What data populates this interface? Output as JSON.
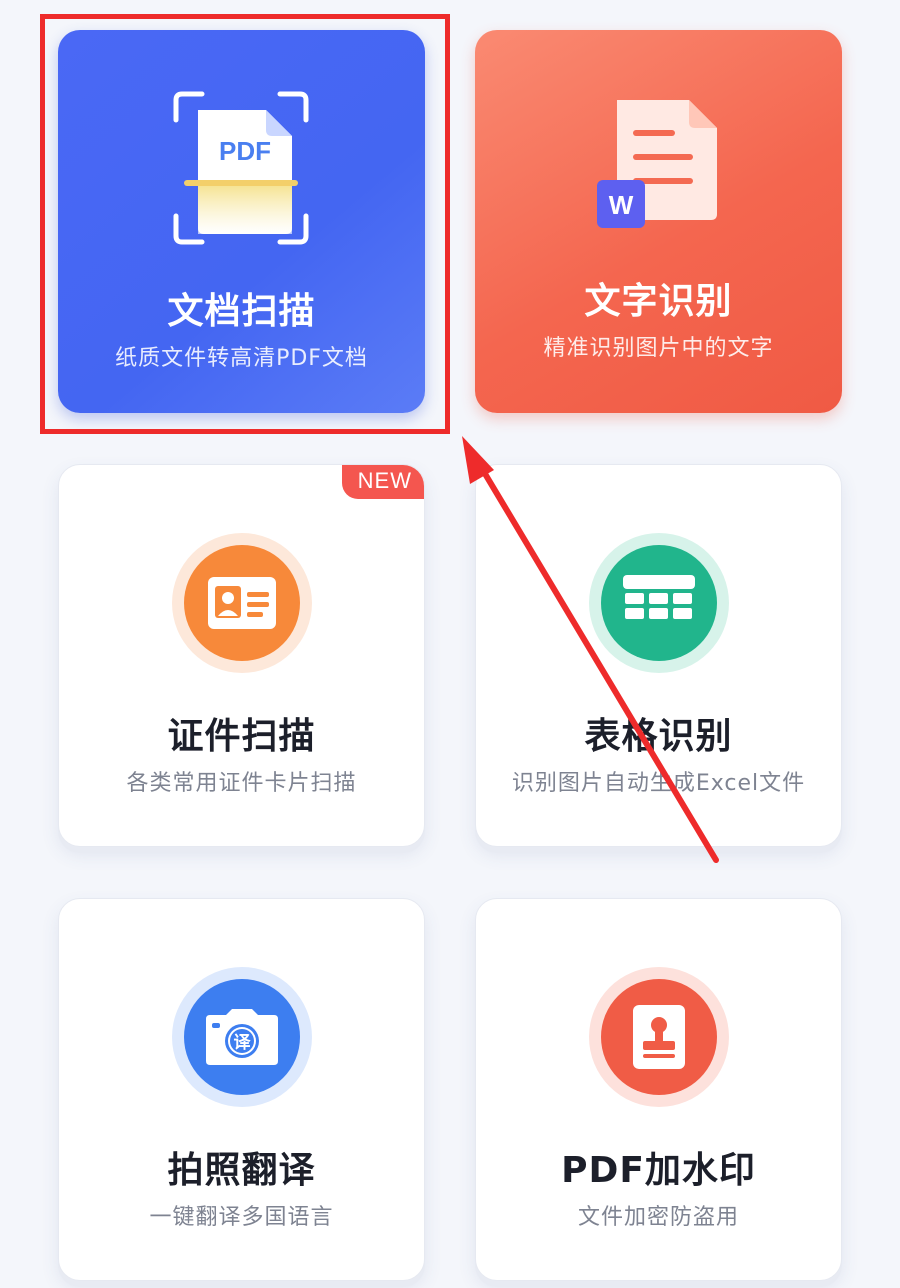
{
  "cards": [
    {
      "id": "doc-scan",
      "title": "文档扫描",
      "subtitle": "纸质文件转高清PDF文档",
      "icon": "pdf-scan-icon",
      "icon_text": "PDF",
      "color": "#4a68f5"
    },
    {
      "id": "text-recognition",
      "title": "文字识别",
      "subtitle": "精准识别图片中的文字",
      "icon": "word-document-icon",
      "icon_text": "W",
      "color": "#f4664f"
    },
    {
      "id": "id-scan",
      "title": "证件扫描",
      "subtitle": "各类常用证件卡片扫描",
      "icon": "id-card-icon",
      "badge": "NEW",
      "color": "#f7893a"
    },
    {
      "id": "table-recognition",
      "title": "表格识别",
      "subtitle": "识别图片自动生成Excel文件",
      "icon": "table-icon",
      "color": "#21b58c"
    },
    {
      "id": "photo-translate",
      "title": "拍照翻译",
      "subtitle": "一键翻译多国语言",
      "icon": "camera-translate-icon",
      "icon_text": "译",
      "color": "#3d7ef0"
    },
    {
      "id": "pdf-watermark",
      "title": "PDF加水印",
      "subtitle": "文件加密防盗用",
      "icon": "stamp-icon",
      "color": "#f05c46"
    }
  ],
  "annotation": {
    "highlight_color": "#ee2b2b",
    "arrow_color": "#ee2b2b"
  }
}
